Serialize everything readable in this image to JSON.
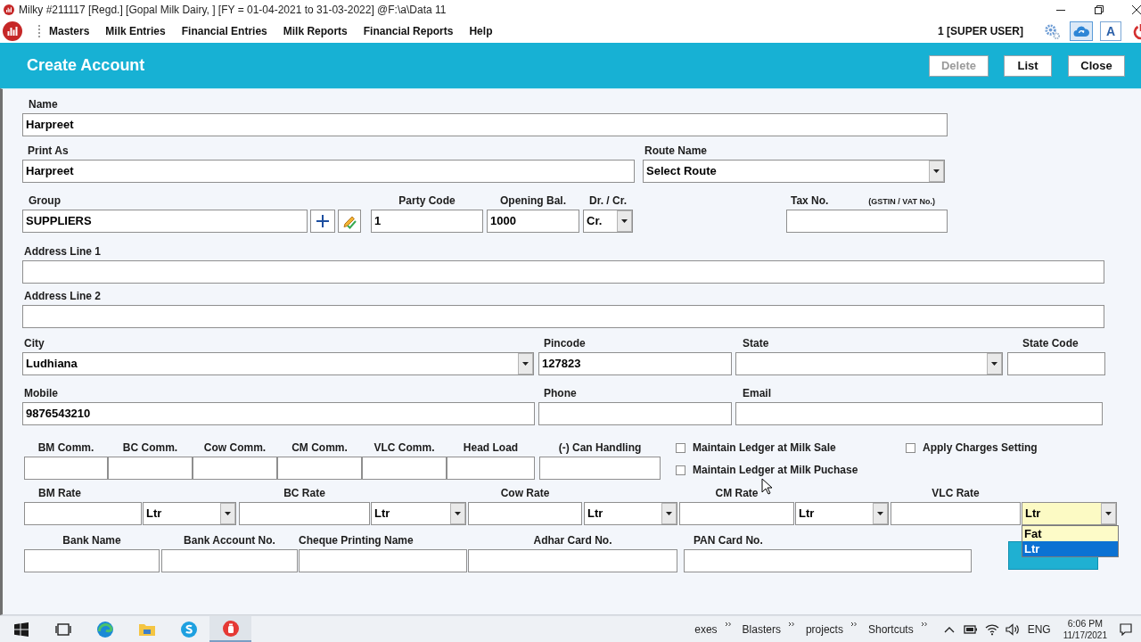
{
  "title_bar": {
    "title": "Milky #211117 [Regd.] [Gopal Milk Dairy, ] [FY = 01-04-2021 to 31-03-2022] @F:\\a\\Data 11"
  },
  "menu_bar": {
    "items": [
      {
        "label": "Masters"
      },
      {
        "label": "Milk Entries"
      },
      {
        "label": "Financial Entries"
      },
      {
        "label": "Milk Reports"
      },
      {
        "label": "Financial Reports"
      },
      {
        "label": "Help"
      }
    ],
    "user": "1 [SUPER USER]",
    "font_button": "A"
  },
  "header": {
    "title": "Create Account",
    "buttons": [
      {
        "label": "Delete",
        "disabled": true
      },
      {
        "label": "List",
        "disabled": false
      },
      {
        "label": "Close",
        "disabled": false
      }
    ]
  },
  "form": {
    "name": {
      "label": "Name",
      "value": "Harpreet"
    },
    "print_as": {
      "label": "Print As",
      "value": "Harpreet"
    },
    "route_name": {
      "label": "Route Name",
      "value": "Select Route"
    },
    "group": {
      "label": "Group",
      "value": "SUPPLIERS"
    },
    "party_code": {
      "label": "Party Code",
      "value": "1"
    },
    "opening_balance": {
      "label": "Opening Bal.",
      "value": "1000"
    },
    "dr_cr": {
      "label": "Dr. / Cr.",
      "value": "Cr."
    },
    "tax_no": {
      "label": "Tax No.",
      "note": "(GSTIN / VAT No.)"
    },
    "address_line_1": {
      "label": "Address Line 1"
    },
    "address_line_2": {
      "label": "Address Line 2"
    },
    "city": {
      "label": "City",
      "value": "Ludhiana"
    },
    "pincode": {
      "label": "Pincode",
      "value": "127823"
    },
    "state": {
      "label": "State"
    },
    "state_code": {
      "label": "State Code"
    },
    "mobile": {
      "label": "Mobile",
      "value": "9876543210"
    },
    "phone": {
      "label": "Phone"
    },
    "email": {
      "label": "Email"
    },
    "commissions": [
      {
        "label": "BM Comm."
      },
      {
        "label": "BC Comm."
      },
      {
        "label": "Cow Comm."
      },
      {
        "label": "CM Comm."
      },
      {
        "label": "VLC Comm."
      },
      {
        "label": "Head Load"
      },
      {
        "label": "(-) Can Handling"
      }
    ],
    "ledger_options": [
      {
        "label": "Maintain Ledger at Milk Sale",
        "checked": false
      },
      {
        "label": "Maintain Ledger at Milk Puchase",
        "checked": false
      }
    ],
    "apply_charges": {
      "label": "Apply Charges Setting",
      "checked": false
    },
    "rates": [
      {
        "label": "BM Rate",
        "unit": "Ltr",
        "expanded": false
      },
      {
        "label": "BC Rate",
        "unit": "Ltr",
        "expanded": false
      },
      {
        "label": "Cow Rate",
        "unit": "Ltr",
        "expanded": false
      },
      {
        "label": "CM Rate",
        "unit": "Ltr",
        "expanded": false
      },
      {
        "label": "VLC Rate",
        "unit": "Ltr",
        "expanded": true,
        "options": [
          {
            "label": "Fat",
            "selected": false
          },
          {
            "label": "Ltr",
            "selected": true
          }
        ]
      }
    ],
    "bank_details": [
      {
        "label": "Bank Name"
      },
      {
        "label": "Bank Account No."
      },
      {
        "label": "Cheque Printing Name"
      },
      {
        "label": "Adhar Card No."
      },
      {
        "label": "PAN Card No."
      }
    ]
  },
  "taskbar": {
    "apps": [
      {
        "active": false
      },
      {
        "active": false
      },
      {
        "active": false
      },
      {
        "active": false
      },
      {
        "active": false
      },
      {
        "active": true
      }
    ],
    "toolbars": [
      {
        "label": "exes"
      },
      {
        "label": "Blasters"
      },
      {
        "label": "projects"
      },
      {
        "label": "Shortcuts"
      }
    ],
    "language": "ENG",
    "time": "6:06 PM",
    "date": "11/17/2021"
  }
}
